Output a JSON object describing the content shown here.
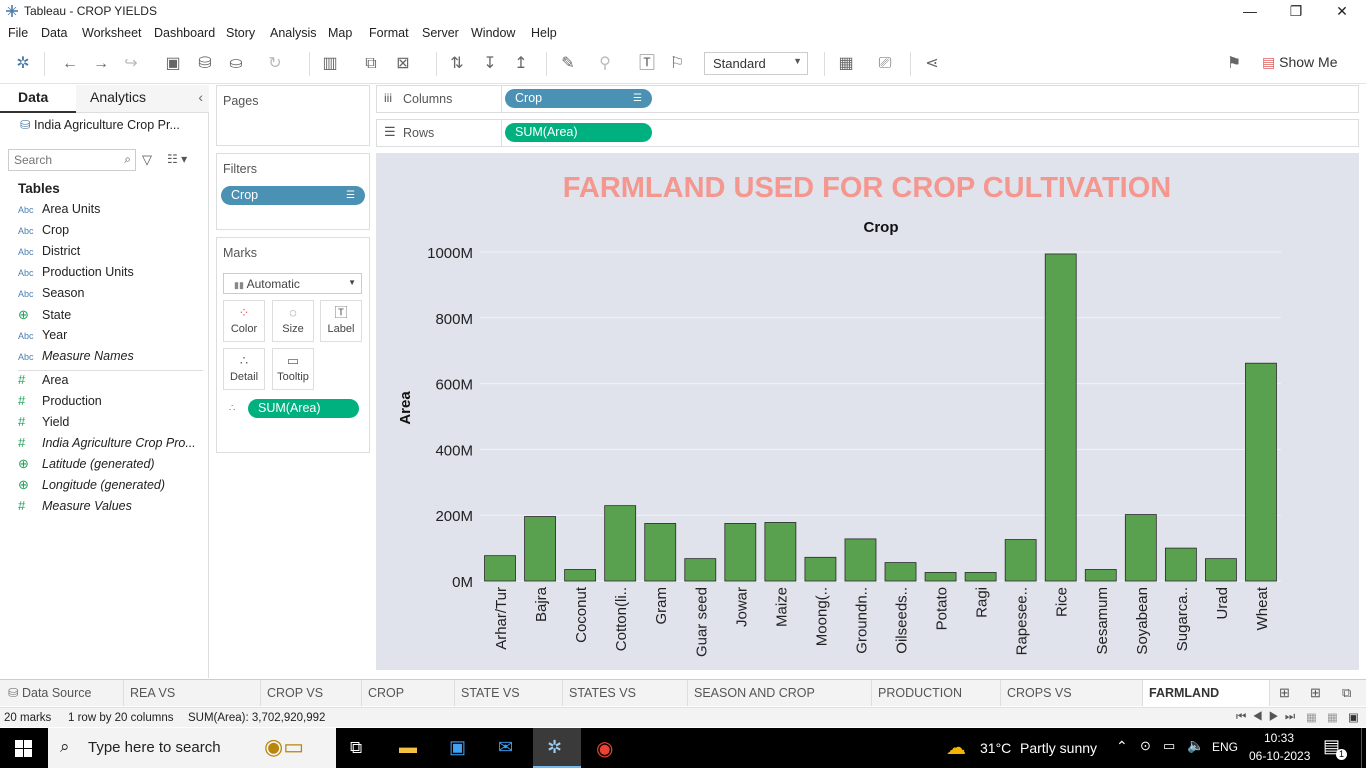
{
  "window": {
    "title": "Tableau - CROP YIELDS",
    "minimize": "—",
    "restore": "❐",
    "close": "✕"
  },
  "menu": [
    "File",
    "Data",
    "Worksheet",
    "Dashboard",
    "Story",
    "Analysis",
    "Map",
    "Format",
    "Server",
    "Window",
    "Help"
  ],
  "toolbar": {
    "fit_option": "Standard",
    "show_me": "Show Me"
  },
  "datapane": {
    "tab_data": "Data",
    "tab_analytics": "Analytics",
    "source": "India Agriculture Crop Pr...",
    "search_placeholder": "Search",
    "tables_heading": "Tables",
    "fields": [
      {
        "type": "Abc",
        "name": "Area Units",
        "italic": false
      },
      {
        "type": "Abc",
        "name": "Crop",
        "italic": false
      },
      {
        "type": "Abc",
        "name": "District",
        "italic": false
      },
      {
        "type": "Abc",
        "name": "Production Units",
        "italic": false
      },
      {
        "type": "Abc",
        "name": "Season",
        "italic": false
      },
      {
        "type": "globe",
        "name": "State",
        "italic": false
      },
      {
        "type": "Abc",
        "name": "Year",
        "italic": false
      },
      {
        "type": "Abc",
        "name": "Measure Names",
        "italic": true
      }
    ],
    "measures": [
      {
        "type": "#",
        "name": "Area",
        "italic": false
      },
      {
        "type": "#",
        "name": "Production",
        "italic": false
      },
      {
        "type": "#",
        "name": "Yield",
        "italic": false
      },
      {
        "type": "#",
        "name": "India Agriculture Crop Pro...",
        "italic": true
      },
      {
        "type": "globe",
        "name": "Latitude (generated)",
        "italic": true
      },
      {
        "type": "globe",
        "name": "Longitude (generated)",
        "italic": true
      },
      {
        "type": "#",
        "name": "Measure Values",
        "italic": true
      }
    ]
  },
  "pages": {
    "label": "Pages"
  },
  "filters": {
    "label": "Filters",
    "pill": "Crop"
  },
  "marks": {
    "label": "Marks",
    "type": "Automatic",
    "buttons": [
      "Color",
      "Size",
      "Label",
      "Detail",
      "Tooltip"
    ],
    "pill": "SUM(Area)"
  },
  "shelves": {
    "columns_label": "Columns",
    "columns_pill": "Crop",
    "rows_label": "Rows",
    "rows_pill": "SUM(Area)"
  },
  "chart_data": {
    "type": "bar",
    "title": "FARMLAND USED FOR CROP CULTIVATION",
    "header": "Crop",
    "xlabel": "",
    "ylabel": "Area",
    "ylim": [
      0,
      1000000000
    ],
    "yticks": [
      "0M",
      "200M",
      "400M",
      "600M",
      "800M",
      "1000M"
    ],
    "ytick_values": [
      0,
      200000000,
      400000000,
      600000000,
      800000000,
      1000000000
    ],
    "categories": [
      "Arhar/Tur",
      "Bajra",
      "Coconut",
      "Cotton(li..",
      "Gram",
      "Guar seed",
      "Jowar",
      "Maize",
      "Moong(..",
      "Groundn..",
      "Oilseeds..",
      "Potato",
      "Ragi",
      "Rapesee..",
      "Rice",
      "Sesamum",
      "Soyabean",
      "Sugarca..",
      "Urad",
      "Wheat"
    ],
    "values": [
      77000000,
      196000000,
      35000000,
      229000000,
      175000000,
      68000000,
      175000000,
      178000000,
      72000000,
      128000000,
      56000000,
      26000000,
      26000000,
      126000000,
      994000000,
      35000000,
      202000000,
      100000000,
      68000000,
      662000000
    ],
    "bar_color": "#59a14f",
    "title_color": "#f4978e",
    "background": "#e0e2ec",
    "grid": true
  },
  "sheet_tabs": [
    "Data Source",
    "REA VS PRODUCTION",
    "CROP VS YEAR",
    "CROP YIELDS",
    "STATE VS CROP",
    "STATES VS YEILDS",
    "SEASON AND CROP COUNTS",
    "PRODUCTION YEAR",
    "CROPS VS DISTRICTS",
    "FARMLAND CROPS"
  ],
  "active_tab": "FARMLAND CROPS",
  "status": {
    "marks": "20 marks",
    "rows": "1 row by 20 columns",
    "sum": "SUM(Area): 3,702,920,992"
  },
  "taskbar": {
    "search_placeholder": "Type here to search",
    "weather_temp": "31°C",
    "weather_text": "Partly sunny",
    "lang": "ENG",
    "time": "10:33",
    "date": "06-10-2023",
    "notifications": "1"
  }
}
